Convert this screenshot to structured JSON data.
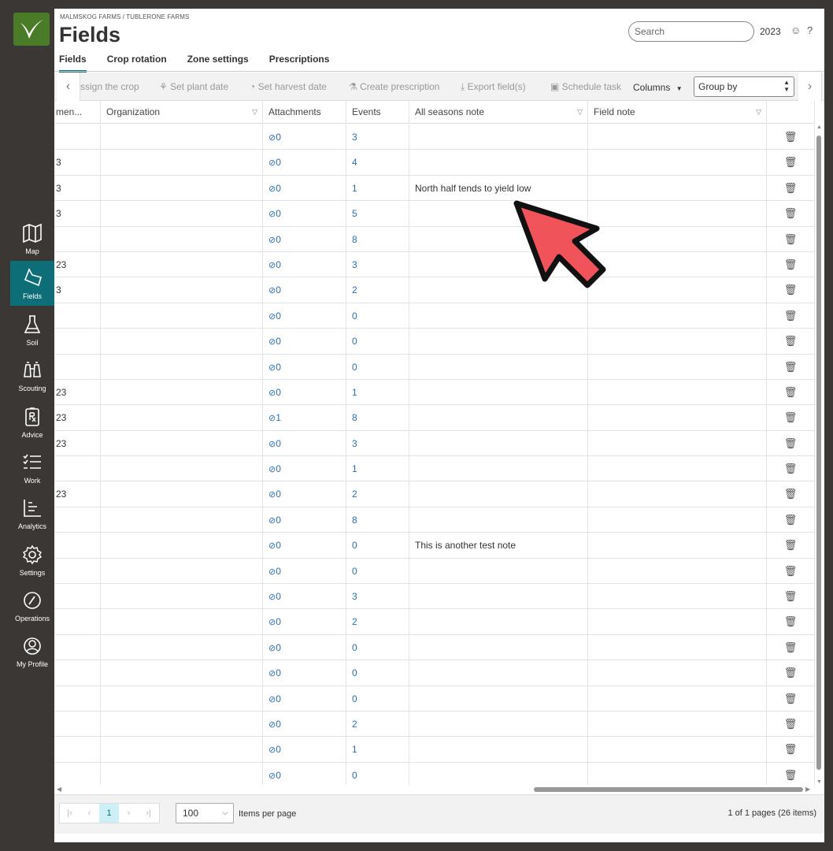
{
  "nav": {
    "items": [
      {
        "label": "Map",
        "icon": "map-icon"
      },
      {
        "label": "Fields",
        "icon": "field-icon"
      },
      {
        "label": "Soil",
        "icon": "flask-icon"
      },
      {
        "label": "Scouting",
        "icon": "binoculars-icon"
      },
      {
        "label": "Advice",
        "icon": "prescription-icon"
      },
      {
        "label": "Work",
        "icon": "checklist-icon"
      },
      {
        "label": "Analytics",
        "icon": "chart-icon"
      },
      {
        "label": "Settings",
        "icon": "gear-icon"
      },
      {
        "label": "Operations",
        "icon": "gauge-icon"
      },
      {
        "label": "My Profile",
        "icon": "profile-icon"
      }
    ]
  },
  "header": {
    "breadcrumb": "MALMSKOG FARMS / TUBLERONE FARMS",
    "title": "Fields",
    "search_placeholder": "Search",
    "year": "2023",
    "smiley": "☺",
    "help": "?"
  },
  "tabs": [
    "Fields",
    "Crop rotation",
    "Zone settings",
    "Prescriptions"
  ],
  "toolbar": {
    "assign": "ssign the crop",
    "plant": "Set plant date",
    "harvest": "Set harvest date",
    "prescription": "Create prescription",
    "export": "Export field(s)",
    "schedule": "Schedule task",
    "columns": "Columns",
    "group_by": "Group by"
  },
  "columns": [
    "men...",
    "Organization",
    "Attachments",
    "Events",
    "All seasons note",
    "Field note"
  ],
  "rows": [
    {
      "c1": "",
      "att": "0",
      "ev": "3",
      "note": ""
    },
    {
      "c1": "3",
      "att": "0",
      "ev": "4",
      "note": ""
    },
    {
      "c1": "3",
      "att": "0",
      "ev": "1",
      "note": "North half tends to yield low"
    },
    {
      "c1": "3",
      "att": "0",
      "ev": "5",
      "note": ""
    },
    {
      "c1": "",
      "att": "0",
      "ev": "8",
      "note": ""
    },
    {
      "c1": "23",
      "att": "0",
      "ev": "3",
      "note": ""
    },
    {
      "c1": "3",
      "att": "0",
      "ev": "2",
      "note": ""
    },
    {
      "c1": "",
      "att": "0",
      "ev": "0",
      "note": ""
    },
    {
      "c1": "",
      "att": "0",
      "ev": "0",
      "note": ""
    },
    {
      "c1": "",
      "att": "0",
      "ev": "0",
      "note": ""
    },
    {
      "c1": "23",
      "att": "0",
      "ev": "1",
      "note": ""
    },
    {
      "c1": "23",
      "att": "1",
      "ev": "8",
      "note": ""
    },
    {
      "c1": "23",
      "att": "0",
      "ev": "3",
      "note": ""
    },
    {
      "c1": "",
      "att": "0",
      "ev": "1",
      "note": ""
    },
    {
      "c1": "23",
      "att": "0",
      "ev": "2",
      "note": ""
    },
    {
      "c1": "",
      "att": "0",
      "ev": "8",
      "note": ""
    },
    {
      "c1": "",
      "att": "0",
      "ev": "0",
      "note": "This is another test note"
    },
    {
      "c1": "",
      "att": "0",
      "ev": "0",
      "note": ""
    },
    {
      "c1": "",
      "att": "0",
      "ev": "3",
      "note": ""
    },
    {
      "c1": "",
      "att": "0",
      "ev": "2",
      "note": ""
    },
    {
      "c1": "",
      "att": "0",
      "ev": "0",
      "note": ""
    },
    {
      "c1": "",
      "att": "0",
      "ev": "0",
      "note": ""
    },
    {
      "c1": "",
      "att": "0",
      "ev": "0",
      "note": ""
    },
    {
      "c1": "",
      "att": "0",
      "ev": "2",
      "note": ""
    },
    {
      "c1": "",
      "att": "0",
      "ev": "1",
      "note": ""
    },
    {
      "c1": "",
      "att": "0",
      "ev": "0",
      "note": ""
    }
  ],
  "pagination": {
    "current_page": "1",
    "per_page": "100",
    "items_per_page_label": "Items per page",
    "summary": "1 of 1 pages (26 items)"
  },
  "colors": {
    "accent": "#0e6e78",
    "link": "#2a6fb0",
    "cursor": "#f0545a"
  }
}
